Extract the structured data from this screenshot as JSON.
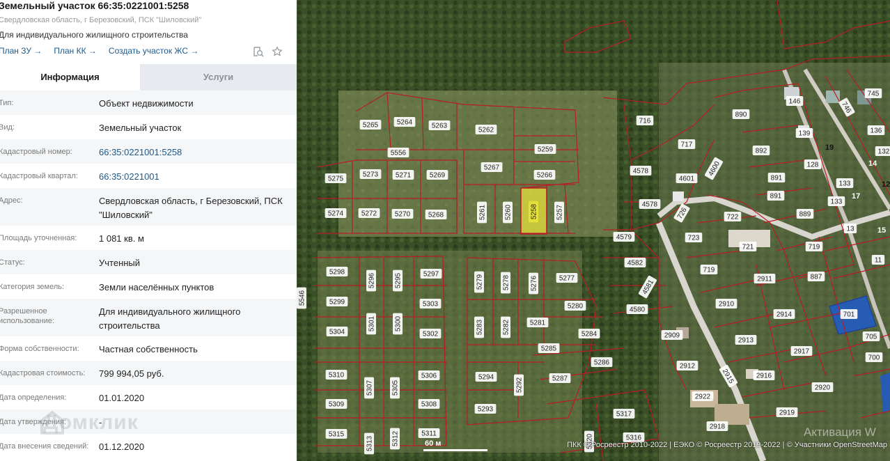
{
  "header": {
    "title": "Земельный участок 66:35:0221001:5258",
    "subtitle": "Свердловская область, г Березовский, ПСК \"Шиловский\"",
    "purpose": "Для индивидуального жилищного строительства",
    "links": [
      "План ЗУ →",
      "План КК →",
      "Создать участок ЖС →"
    ],
    "icons": [
      "search-document-icon",
      "star-icon"
    ]
  },
  "tabs": [
    {
      "label": "Информация",
      "active": true
    },
    {
      "label": "Услуги",
      "active": false
    }
  ],
  "info": [
    {
      "label": "Тип:",
      "value": "Объект недвижимости",
      "link": false
    },
    {
      "label": "Вид:",
      "value": "Земельный участок",
      "link": false
    },
    {
      "label": "Кадастровый номер:",
      "value": "66:35:0221001:5258",
      "link": true
    },
    {
      "label": "Кадастровый квартал:",
      "value": "66:35:0221001",
      "link": true
    },
    {
      "label": "Адрес:",
      "value": "Свердловская область, г Березовский, ПСК \"Шиловский\"",
      "link": false
    },
    {
      "label": "Площадь уточненная:",
      "value": "1 081 кв. м",
      "link": false
    },
    {
      "label": "Статус:",
      "value": "Учтенный",
      "link": false
    },
    {
      "label": "Категория земель:",
      "value": "Земли населённых пунктов",
      "link": false
    },
    {
      "label": "Разрешенное использование:",
      "value": "Для индивидуального жилищного строительства",
      "link": false
    },
    {
      "label": "Форма собственности:",
      "value": "Частная собственность",
      "link": false
    },
    {
      "label": "Кадастровая стоимость:",
      "value": "799 994,05 руб.",
      "link": false
    },
    {
      "label": "Дата определения:",
      "value": "01.01.2020",
      "link": false
    },
    {
      "label": "Дата утверждения:",
      "value": "-",
      "link": false
    },
    {
      "label": "Дата внесения сведений:",
      "value": "01.12.2020",
      "link": false
    }
  ],
  "watermark": "Домклик",
  "map": {
    "scale_label": "60 м",
    "attribution": "ПКК © Росреестр 2010-2022 | ЕЭКО © Росреестр 2019-2022 | © Участники OpenStreetMap",
    "activation_text": "Активация W",
    "selected_parcel": "5258",
    "selected_color": "#e6e23a",
    "boundary_color": "#b81d24",
    "parcels": [
      {
        "id": "5265",
        "label": "5265"
      },
      {
        "id": "5264",
        "label": "5264"
      },
      {
        "id": "5263",
        "label": "5263"
      },
      {
        "id": "5262",
        "label": "5262"
      },
      {
        "id": "5556",
        "label": "5556"
      },
      {
        "id": "5259",
        "label": "5259"
      },
      {
        "id": "5267",
        "label": "5267"
      },
      {
        "id": "5266",
        "label": "5266"
      },
      {
        "id": "5275",
        "label": "5275"
      },
      {
        "id": "5273",
        "label": "5273"
      },
      {
        "id": "5271",
        "label": "5271"
      },
      {
        "id": "5269",
        "label": "5269"
      },
      {
        "id": "5274",
        "label": "5274"
      },
      {
        "id": "5272",
        "label": "5272"
      },
      {
        "id": "5270",
        "label": "5270"
      },
      {
        "id": "5268",
        "label": "5268"
      },
      {
        "id": "5261",
        "label": "5261"
      },
      {
        "id": "5260",
        "label": "5260"
      },
      {
        "id": "5258",
        "label": "5258"
      },
      {
        "id": "5257",
        "label": "5257"
      },
      {
        "id": "5298",
        "label": "5298"
      },
      {
        "id": "5296",
        "label": "5296"
      },
      {
        "id": "5295",
        "label": "5295"
      },
      {
        "id": "5297",
        "label": "5297"
      },
      {
        "id": "5279",
        "label": "5279"
      },
      {
        "id": "5278",
        "label": "5278"
      },
      {
        "id": "5276",
        "label": "5276"
      },
      {
        "id": "5277",
        "label": "5277"
      },
      {
        "id": "5299",
        "label": "5299"
      },
      {
        "id": "5303",
        "label": "5303"
      },
      {
        "id": "5280",
        "label": "5280"
      },
      {
        "id": "5304",
        "label": "5304"
      },
      {
        "id": "5301",
        "label": "5301"
      },
      {
        "id": "5300",
        "label": "5300"
      },
      {
        "id": "5302",
        "label": "5302"
      },
      {
        "id": "5283",
        "label": "5283"
      },
      {
        "id": "5282",
        "label": "5282"
      },
      {
        "id": "5281",
        "label": "5281"
      },
      {
        "id": "5284",
        "label": "5284"
      },
      {
        "id": "5285",
        "label": "5285"
      },
      {
        "id": "5286",
        "label": "5286"
      },
      {
        "id": "5310",
        "label": "5310"
      },
      {
        "id": "5307",
        "label": "5307"
      },
      {
        "id": "5305",
        "label": "5305"
      },
      {
        "id": "5306",
        "label": "5306"
      },
      {
        "id": "5294",
        "label": "5294"
      },
      {
        "id": "5292",
        "label": "5292"
      },
      {
        "id": "5287",
        "label": "5287"
      },
      {
        "id": "5309",
        "label": "5309"
      },
      {
        "id": "5308",
        "label": "5308"
      },
      {
        "id": "5293",
        "label": "5293"
      },
      {
        "id": "5315",
        "label": "5315"
      },
      {
        "id": "5313",
        "label": "5313"
      },
      {
        "id": "5312",
        "label": "5312"
      },
      {
        "id": "5311",
        "label": "5311"
      },
      {
        "id": "5317",
        "label": "5317"
      },
      {
        "id": "5316",
        "label": "5316"
      },
      {
        "id": "5320",
        "label": "5320"
      },
      {
        "id": "5546",
        "label": "5546"
      },
      {
        "id": "716",
        "label": "716"
      },
      {
        "id": "717",
        "label": "717"
      },
      {
        "id": "4578a",
        "label": "4578"
      },
      {
        "id": "4601",
        "label": "4601"
      },
      {
        "id": "4600",
        "label": "4600"
      },
      {
        "id": "4578b",
        "label": "4578"
      },
      {
        "id": "4579",
        "label": "4579"
      },
      {
        "id": "4582",
        "label": "4582"
      },
      {
        "id": "4581",
        "label": "4581"
      },
      {
        "id": "4580",
        "label": "4580"
      },
      {
        "id": "726",
        "label": "726"
      },
      {
        "id": "722",
        "label": "722"
      },
      {
        "id": "723",
        "label": "723"
      },
      {
        "id": "721",
        "label": "721"
      },
      {
        "id": "719a",
        "label": "719"
      },
      {
        "id": "2909",
        "label": "2909"
      },
      {
        "id": "2910",
        "label": "2910"
      },
      {
        "id": "2911",
        "label": "2911"
      },
      {
        "id": "2912",
        "label": "2912"
      },
      {
        "id": "2913",
        "label": "2913"
      },
      {
        "id": "2914",
        "label": "2914"
      },
      {
        "id": "2915",
        "label": "2915"
      },
      {
        "id": "2916",
        "label": "2916"
      },
      {
        "id": "2917",
        "label": "2917"
      },
      {
        "id": "2918",
        "label": "2918"
      },
      {
        "id": "2919",
        "label": "2919"
      },
      {
        "id": "2920",
        "label": "2920"
      },
      {
        "id": "2922",
        "label": "2922"
      },
      {
        "id": "890",
        "label": "890"
      },
      {
        "id": "892",
        "label": "892"
      },
      {
        "id": "891a",
        "label": "891"
      },
      {
        "id": "891b",
        "label": "891"
      },
      {
        "id": "889",
        "label": "889"
      },
      {
        "id": "887",
        "label": "887"
      },
      {
        "id": "719b",
        "label": "719"
      },
      {
        "id": "146",
        "label": "146"
      },
      {
        "id": "139",
        "label": "139"
      },
      {
        "id": "128",
        "label": "128"
      },
      {
        "id": "133a",
        "label": "133"
      },
      {
        "id": "133b",
        "label": "133"
      },
      {
        "id": "746",
        "label": "746"
      },
      {
        "id": "745",
        "label": "745"
      },
      {
        "id": "136",
        "label": "136"
      },
      {
        "id": "132",
        "label": "132"
      },
      {
        "id": "13",
        "label": "13"
      },
      {
        "id": "11",
        "label": "11"
      },
      {
        "id": "701",
        "label": "701"
      },
      {
        "id": "705",
        "label": "705"
      },
      {
        "id": "700",
        "label": "700"
      }
    ],
    "house_numbers": [
      "19",
      "14",
      "17",
      "12",
      "15"
    ]
  }
}
